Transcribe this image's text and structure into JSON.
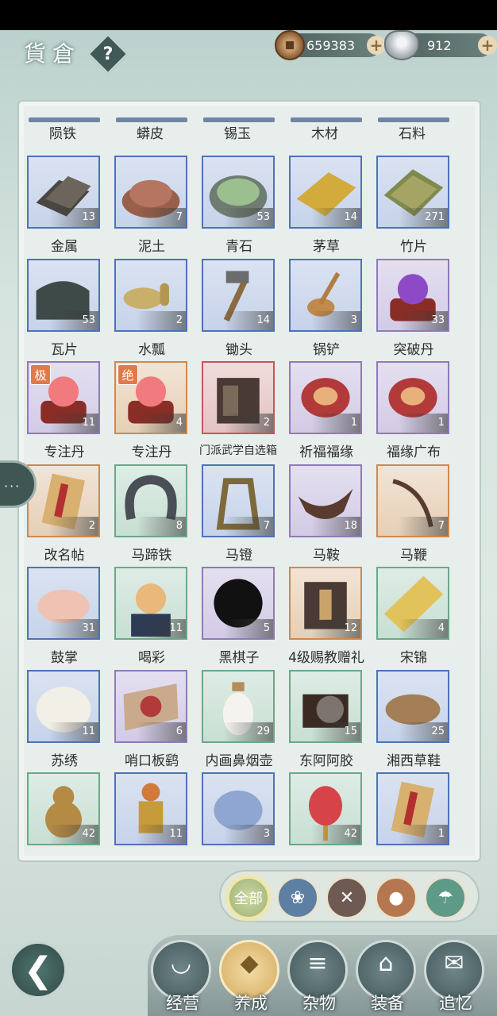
{
  "header": {
    "title": "貨倉",
    "help_label": "?",
    "copper_coins": "659383",
    "silver": "912",
    "plus_label": "+"
  },
  "top_row_labels": [
    "陨铁",
    "蟒皮",
    "锡玉",
    "木材",
    "石料"
  ],
  "items": [
    {
      "name": "金属",
      "count": "13",
      "frame": "blue",
      "icon": "metal-ingot-icon"
    },
    {
      "name": "泥土",
      "count": "7",
      "frame": "blue",
      "icon": "soil-pile-icon"
    },
    {
      "name": "青石",
      "count": "53",
      "frame": "blue",
      "icon": "green-stone-icon"
    },
    {
      "name": "茅草",
      "count": "14",
      "frame": "blue",
      "icon": "thatch-icon"
    },
    {
      "name": "竹片",
      "count": "271",
      "frame": "blue",
      "icon": "bamboo-slats-icon"
    },
    {
      "name": "瓦片",
      "count": "53",
      "frame": "blue",
      "icon": "roof-tiles-icon"
    },
    {
      "name": "水瓢",
      "count": "2",
      "frame": "blue",
      "icon": "gourd-ladle-icon"
    },
    {
      "name": "锄头",
      "count": "14",
      "frame": "blue",
      "icon": "hoe-icon"
    },
    {
      "name": "锅铲",
      "count": "3",
      "frame": "blue",
      "icon": "spatula-icon"
    },
    {
      "name": "突破丹",
      "count": "33",
      "frame": "purple",
      "icon": "breakthrough-pill-icon"
    },
    {
      "name": "专注丹",
      "count": "11",
      "frame": "purple",
      "icon": "focus-pill-icon",
      "tag": "极"
    },
    {
      "name": "专注丹",
      "count": "4",
      "frame": "orange",
      "icon": "focus-pill-icon",
      "tag": "绝"
    },
    {
      "name": "门派武学自选箱",
      "count": "2",
      "frame": "red",
      "icon": "martial-chest-icon",
      "small": true
    },
    {
      "name": "祈福福缘",
      "count": "1",
      "frame": "purple",
      "icon": "blessing-pouch-icon"
    },
    {
      "name": "福缘广布",
      "count": "1",
      "frame": "purple",
      "icon": "blessing-pouch-icon"
    },
    {
      "name": "改名帖",
      "count": "2",
      "frame": "orange",
      "icon": "rename-card-icon"
    },
    {
      "name": "马蹄铁",
      "count": "8",
      "frame": "green",
      "icon": "horseshoe-icon"
    },
    {
      "name": "马镫",
      "count": "7",
      "frame": "blue",
      "icon": "stirrup-icon"
    },
    {
      "name": "马鞍",
      "count": "18",
      "frame": "purple",
      "icon": "saddle-icon"
    },
    {
      "name": "马鞭",
      "count": "7",
      "frame": "orange",
      "icon": "whip-icon"
    },
    {
      "name": "鼓掌",
      "count": "31",
      "frame": "blue",
      "icon": "clapping-hands-icon"
    },
    {
      "name": "喝彩",
      "count": "11",
      "frame": "green",
      "icon": "cheering-man-icon"
    },
    {
      "name": "黑棋子",
      "count": "5",
      "frame": "purple",
      "icon": "black-go-stone-icon"
    },
    {
      "name": "4级赐教赠礼",
      "count": "12",
      "frame": "orange",
      "icon": "gift-chest-icon"
    },
    {
      "name": "宋锦",
      "count": "4",
      "frame": "green",
      "icon": "brocade-roll-icon"
    },
    {
      "name": "苏绣",
      "count": "11",
      "frame": "blue",
      "icon": "embroidery-icon"
    },
    {
      "name": "哨口板鹞",
      "count": "6",
      "frame": "purple",
      "icon": "kite-icon"
    },
    {
      "name": "内画鼻烟壶",
      "count": "29",
      "frame": "green",
      "icon": "snuff-bottle-icon"
    },
    {
      "name": "东阿阿胶",
      "count": "15",
      "frame": "green",
      "icon": "donkey-gelatin-icon"
    },
    {
      "name": "湘西草鞋",
      "count": "25",
      "frame": "blue",
      "icon": "straw-sandals-icon"
    },
    {
      "name": "",
      "count": "42",
      "frame": "green",
      "icon": "gourd-icon"
    },
    {
      "name": "",
      "count": "11",
      "frame": "blue",
      "icon": "monkey-king-figure-icon"
    },
    {
      "name": "",
      "count": "3",
      "frame": "blue",
      "icon": "sachet-icon"
    },
    {
      "name": "",
      "count": "42",
      "frame": "green",
      "icon": "red-lantern-icon"
    },
    {
      "name": "",
      "count": "1",
      "frame": "blue",
      "icon": "rename-card-icon"
    }
  ],
  "side": {
    "chat_label": "···"
  },
  "filters": [
    {
      "label": "全部",
      "icon": "all-icon",
      "active": true
    },
    {
      "label": "",
      "icon": "cloth-icon"
    },
    {
      "label": "",
      "icon": "tools-icon"
    },
    {
      "label": "",
      "icon": "coins-icon"
    },
    {
      "label": "",
      "icon": "umbrella-icon"
    }
  ],
  "tabs": [
    {
      "label": "经营",
      "icon": "bowl-icon"
    },
    {
      "label": "养成",
      "icon": "pill-box-icon",
      "active": true
    },
    {
      "label": "杂物",
      "icon": "sticks-icon"
    },
    {
      "label": "装备",
      "icon": "robe-icon"
    },
    {
      "label": "追忆",
      "icon": "letter-icon"
    }
  ],
  "back_label": "❮",
  "colors": {
    "frame_blue": "#4e72b8",
    "frame_purple": "#8f7bb8",
    "frame_orange": "#d0894c",
    "frame_red": "#c8545c",
    "frame_green": "#6aa889"
  }
}
